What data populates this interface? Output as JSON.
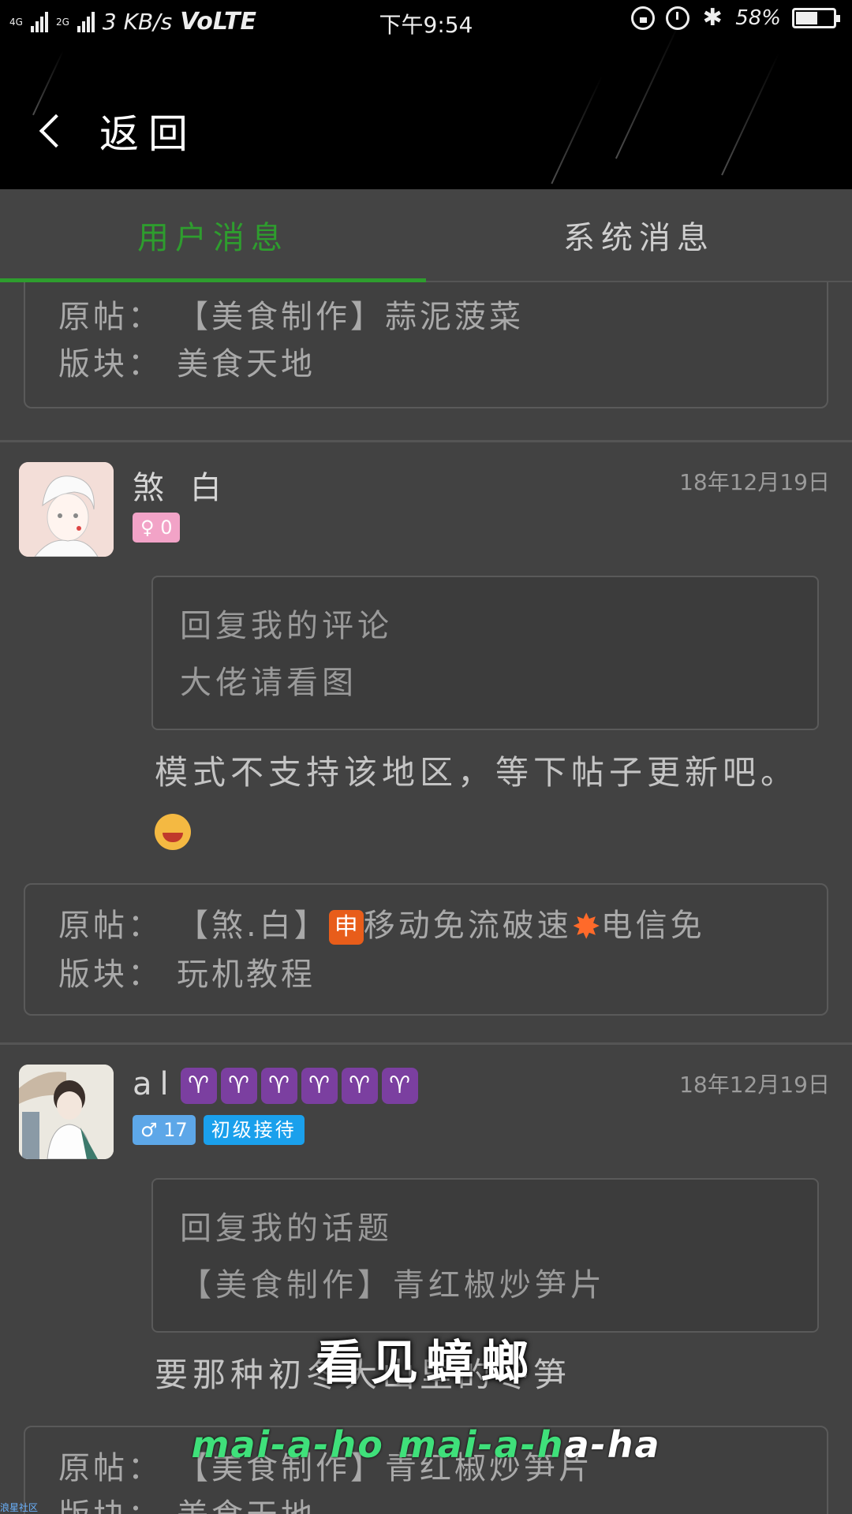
{
  "status_bar": {
    "signal1_label": "4G",
    "signal2_label": "2G",
    "speed": "3 KB/s",
    "volte": "VoLTE",
    "time": "下午9:54",
    "battery_percent_text": "58%",
    "battery_level": 0.58
  },
  "header": {
    "back_label": "返回"
  },
  "tabs": [
    {
      "label": "用户消息",
      "active": true
    },
    {
      "label": "系统消息",
      "active": false
    }
  ],
  "messages": [
    {
      "post": {
        "original_key": "原帖：",
        "original_value": "【美食制作】蒜泥菠菜",
        "board_key": "版块：",
        "board_value": "美食天地"
      }
    },
    {
      "user": {
        "name": "煞 白",
        "gender_badge": "♀ 0"
      },
      "date": "18年12月19日",
      "quote": [
        "回复我的评论",
        "大佬请看图"
      ],
      "text": "模式不支持该地区，等下帖子更新吧。",
      "post": {
        "original_key": "原帖：",
        "original_value_prefix": "【煞.白】",
        "tag_icon": "申",
        "original_value_mid": "移动免流破速",
        "original_value_suffix": "电信免",
        "board_key": "版块：",
        "board_value": "玩机教程"
      }
    },
    {
      "user": {
        "name": "al",
        "zodiac_icon": "♈",
        "zodiac_count": 6,
        "gender_badge": "♂ 17",
        "level_badge": "初级接待"
      },
      "date": "18年12月19日",
      "quote": [
        "回复我的话题",
        "【美食制作】青红椒炒笋片"
      ],
      "text": "要那种初冬大山里的冬笋",
      "post": {
        "original_key": "原帖：",
        "original_value": "【美食制作】青红椒炒笋片",
        "board_key": "版块：",
        "board_value": "美食天地"
      }
    }
  ],
  "overlay": {
    "subtitle_cn": "看见蟑螂",
    "subtitle_en_highlight": "mai-a-ho mai-a-h",
    "subtitle_en_rest": "a-ha",
    "watermark": "浪星社区"
  },
  "colors": {
    "accent_green": "#2e9d2e",
    "background": "#424242",
    "level_badge": "#1aa0ec"
  }
}
